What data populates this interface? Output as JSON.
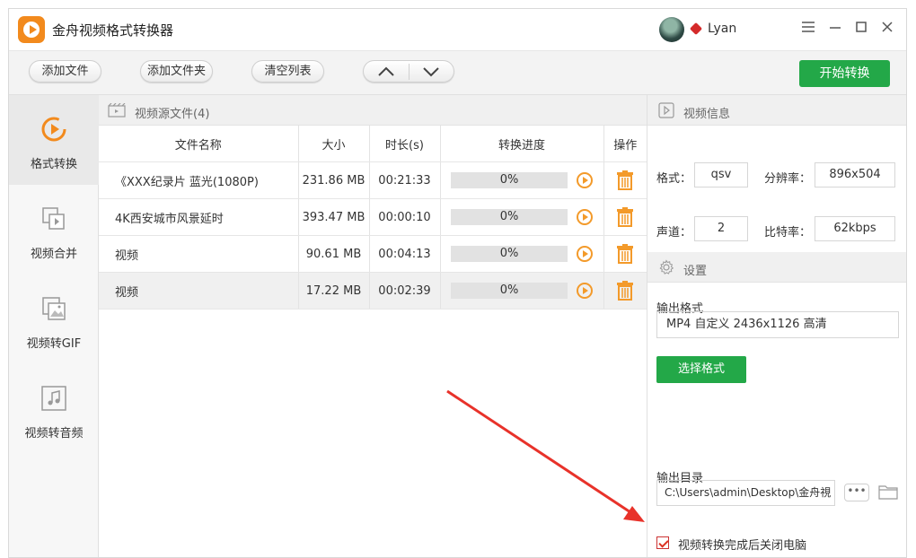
{
  "app": {
    "title": "金舟视频格式转换器",
    "username": "Lyan"
  },
  "toolbar": {
    "add_file": "添加文件",
    "add_folder": "添加文件夹",
    "clear_list": "清空列表",
    "start": "开始转换"
  },
  "nav": {
    "items": [
      {
        "label": "格式转换",
        "active": true
      },
      {
        "label": "视频合并",
        "active": false
      },
      {
        "label": "视频转GIF",
        "active": false
      },
      {
        "label": "视频转音频",
        "active": false
      }
    ]
  },
  "files": {
    "header": "视频源文件(4)",
    "columns": [
      "文件名称",
      "大小",
      "时长(s)",
      "转换进度",
      "操作"
    ],
    "rows": [
      {
        "name": "《XXX纪录片 蓝光(1080P)",
        "size": "231.86 MB",
        "duration": "00:21:33",
        "progress": "0%"
      },
      {
        "name": "4K西安城市风景延时",
        "size": "393.47 MB",
        "duration": "00:00:10",
        "progress": "0%"
      },
      {
        "name": "视频",
        "size": "90.61 MB",
        "duration": "00:04:13",
        "progress": "0%"
      },
      {
        "name": "视频",
        "size": "17.22 MB",
        "duration": "00:02:39",
        "progress": "0%"
      }
    ],
    "selected_row": 3
  },
  "info": {
    "header": "视频信息",
    "format_label": "格式：",
    "format": "qsv",
    "resolution_label": "分辨率：",
    "resolution": "896x504",
    "channels_label": "声道：",
    "channels": "2",
    "bitrate_label": "比特率：",
    "bitrate": "62kbps"
  },
  "settings": {
    "header": "设置",
    "output_format_label": "输出格式",
    "output_format": "MP4 自定义 2436x1126 高清",
    "select_format": "选择格式",
    "output_dir_label": "输出目录",
    "output_dir": "C:\\Users\\admin\\Desktop\\金舟視",
    "dots": "•••",
    "shutdown_label": "视频转换完成后关闭电脑",
    "shutdown_checked": true
  },
  "colors": {
    "accent_green": "#23a848",
    "accent_orange": "#f28a1d",
    "annotation_red": "#e8322a"
  }
}
